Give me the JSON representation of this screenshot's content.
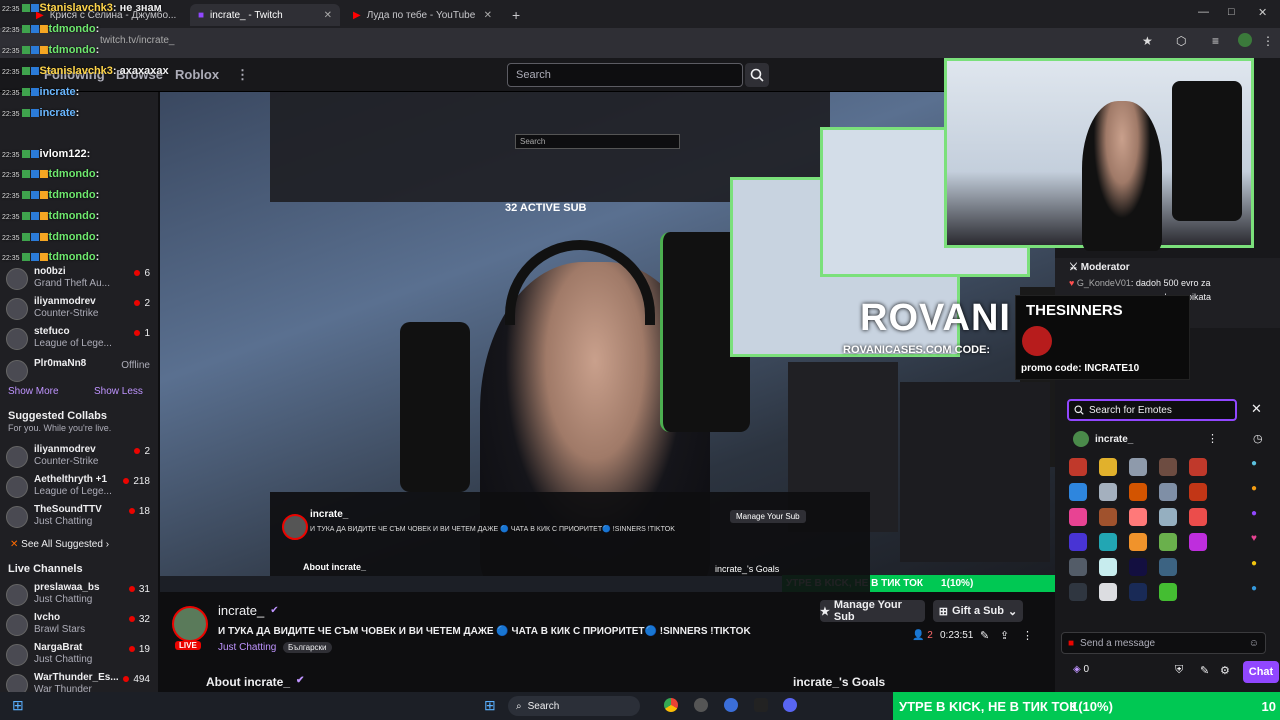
{
  "browser": {
    "tabs": [
      {
        "label": "Крися с Селина - Джумбо..."
      },
      {
        "label": "incrate_ - Twitch"
      },
      {
        "label": "Луда по тебе - YouTube"
      }
    ],
    "url": "twitch.tv/incrate_",
    "new_tab": "+",
    "minimize": "—",
    "maximize": "□",
    "close": "✕"
  },
  "topnav": {
    "links": [
      "Following",
      "Browse",
      "Roblox"
    ],
    "search_placeholder": "Search"
  },
  "chat_overlay": [
    {
      "user": "Stanislavchk3",
      "msg": ": не знам",
      "color": "#ffd54a"
    },
    {
      "user": "tdmondo",
      "msg": ":",
      "color": "#6ee86e"
    },
    {
      "user": "tdmondo",
      "msg": ":",
      "color": "#6ee86e"
    },
    {
      "user": "Stanislavchk3",
      "msg": ": ахахахах",
      "color": "#ffd54a"
    },
    {
      "user": "incrate",
      "msg": ":",
      "color": "#6ab7ff"
    },
    {
      "user": "incrate",
      "msg": ":",
      "color": "#6ab7ff"
    },
    {
      "user": "ivlom122",
      "msg": ":",
      "color": "#ffffff"
    },
    {
      "user": "tdmondo",
      "msg": ":",
      "color": "#6ee86e"
    },
    {
      "user": "tdmondo",
      "msg": ":",
      "color": "#6ee86e"
    },
    {
      "user": "tdmondo",
      "msg": ":",
      "color": "#6ee86e"
    },
    {
      "user": "tdmondo",
      "msg": ":",
      "color": "#6ee86e"
    },
    {
      "user": "tdmondo",
      "msg": ":",
      "color": "#6ee86e"
    }
  ],
  "sidebar": {
    "followed": [
      {
        "name": "no0bzi",
        "game": "Grand Theft Au...",
        "viewers": "6"
      },
      {
        "name": "iliyanmodrev",
        "game": "Counter-Strike",
        "viewers": "2"
      },
      {
        "name": "stefuco",
        "game": "League of Lege...",
        "viewers": "1"
      },
      {
        "name": "Plr0maNn8",
        "game": "",
        "viewers": "Offline"
      }
    ],
    "show_more": "Show More",
    "show_less": "Show Less",
    "suggested_collabs_title": "Suggested Collabs",
    "suggested_collabs_sub": "For you. While you're live.",
    "collabs": [
      {
        "name": "iliyanmodrev",
        "game": "Counter-Strike",
        "viewers": "2"
      },
      {
        "name": "Aethelthryth +1",
        "game": "League of Lege...",
        "viewers": "218"
      },
      {
        "name": "TheSoundTTV",
        "game": "Just Chatting",
        "viewers": "18"
      }
    ],
    "see_all_suggested": "See All Suggested",
    "live_channels_title": "Live Channels",
    "live": [
      {
        "name": "preslawaa_bs",
        "game": "Just Chatting",
        "viewers": "31"
      },
      {
        "name": "Ivcho",
        "game": "Brawl Stars",
        "viewers": "32"
      },
      {
        "name": "NargaBrat",
        "game": "Just Chatting",
        "viewers": "19"
      },
      {
        "name": "WarThunder_Es...",
        "game": "War Thunder",
        "viewers": "494"
      }
    ]
  },
  "video": {
    "sponsor1_title": "ROVANI",
    "sponsor1_code": "ROVANICASES.COM CODE:",
    "sponsor2_title": "THESINNERS",
    "sponsor2_code": "promo code: INCRATE10",
    "active_sub": "32 ACTIVE SUB",
    "goal_banner": "УТРЕ В KICK, НЕ В ТИК ТОК",
    "goal_progress": "1(10%)",
    "goal_count": "10"
  },
  "stream_info": {
    "channel": "incrate_",
    "title": "И ТУКА ДА ВИДИТЕ ЧЕ СЪМ ЧОВЕК И ВИ ЧЕТЕМ ДАЖЕ 🔵 ЧАТА В КИК С ПРИОРИТЕТ🔵 !SINNERS !TIKTOK",
    "category": "Just Chatting",
    "tag": "Български",
    "live_badge": "LIVE",
    "manage_sub": "Manage Your Sub",
    "gift_sub": "Gift a Sub",
    "viewers": "2",
    "uptime": "0:23:51",
    "about": "About incrate_",
    "goals": "incrate_'s Goals"
  },
  "chat_panel": {
    "moderator_label": "Moderator",
    "mod_user": "G_KondeV01",
    "mod_msg": "dadoh 500 evro za",
    "mod_msg2": "eshe upoikata",
    "emote_search_placeholder": "Search for Emotes",
    "emote_channel": "incrate_",
    "send_placeholder": "Send a message",
    "points": "0",
    "chat_button": "Chat"
  },
  "taskbar": {
    "search": "Search"
  },
  "colors": {
    "accent": "#9147ff",
    "live_red": "#eb0400",
    "goal_green": "#00c853"
  }
}
